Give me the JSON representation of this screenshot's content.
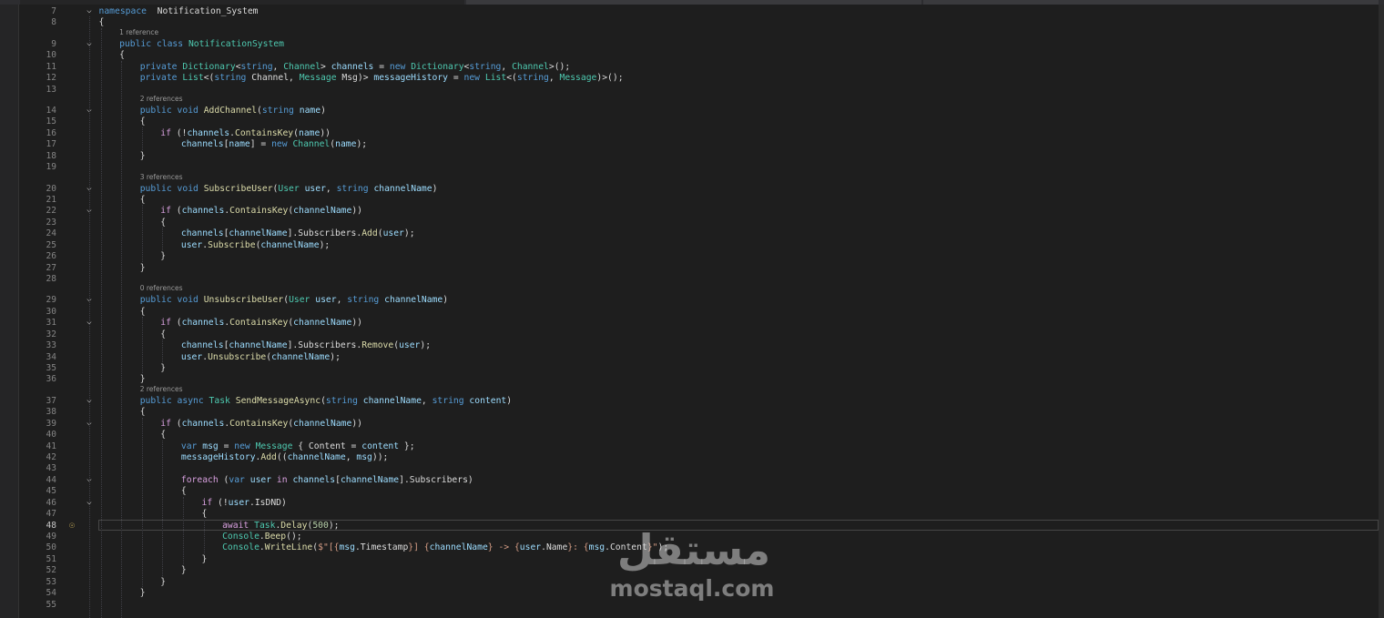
{
  "editor": {
    "current_line": 48,
    "lines": [
      {
        "n": 7,
        "fold": "v",
        "indent": 0,
        "parts": [
          [
            "kw",
            "namespace"
          ],
          [
            "",
            "  "
          ],
          [
            "",
            "Notification_System"
          ]
        ]
      },
      {
        "n": 8,
        "indent": 0,
        "parts": [
          [
            "",
            "{"
          ]
        ]
      },
      {
        "n": 9,
        "fold": "v",
        "indent": 1,
        "lens": "1 reference",
        "parts": [
          [
            "kw",
            "public"
          ],
          [
            "",
            " "
          ],
          [
            "kw",
            "class"
          ],
          [
            "",
            " "
          ],
          [
            "ty",
            "NotificationSystem"
          ]
        ]
      },
      {
        "n": 10,
        "indent": 1,
        "parts": [
          [
            "",
            "{"
          ]
        ]
      },
      {
        "n": 11,
        "indent": 2,
        "parts": [
          [
            "kw",
            "private"
          ],
          [
            "",
            " "
          ],
          [
            "ty",
            "Dictionary"
          ],
          [
            "",
            "<"
          ],
          [
            "kw",
            "string"
          ],
          [
            "",
            ", "
          ],
          [
            "ty",
            "Channel"
          ],
          [
            "",
            "> "
          ],
          [
            "id",
            "channels"
          ],
          [
            "",
            " = "
          ],
          [
            "kw",
            "new"
          ],
          [
            "",
            " "
          ],
          [
            "ty",
            "Dictionary"
          ],
          [
            "",
            "<"
          ],
          [
            "kw",
            "string"
          ],
          [
            "",
            ", "
          ],
          [
            "ty",
            "Channel"
          ],
          [
            "",
            ">();"
          ]
        ]
      },
      {
        "n": 12,
        "indent": 2,
        "parts": [
          [
            "kw",
            "private"
          ],
          [
            "",
            " "
          ],
          [
            "ty",
            "List"
          ],
          [
            "",
            "<("
          ],
          [
            "kw",
            "string"
          ],
          [
            "",
            " Channel, "
          ],
          [
            "ty",
            "Message"
          ],
          [
            "",
            " Msg)> "
          ],
          [
            "id",
            "messageHistory"
          ],
          [
            "",
            " = "
          ],
          [
            "kw",
            "new"
          ],
          [
            "",
            " "
          ],
          [
            "ty",
            "List"
          ],
          [
            "",
            "<("
          ],
          [
            "kw",
            "string"
          ],
          [
            "",
            ", "
          ],
          [
            "ty",
            "Message"
          ],
          [
            "",
            ")>();"
          ]
        ]
      },
      {
        "n": 13,
        "indent": 2,
        "parts": []
      },
      {
        "n": 14,
        "fold": "v",
        "indent": 2,
        "lens": "2 references",
        "parts": [
          [
            "kw",
            "public"
          ],
          [
            "",
            " "
          ],
          [
            "kw",
            "void"
          ],
          [
            "",
            " "
          ],
          [
            "fn",
            "AddChannel"
          ],
          [
            "",
            "("
          ],
          [
            "kw",
            "string"
          ],
          [
            "",
            " "
          ],
          [
            "id",
            "name"
          ],
          [
            "",
            ")"
          ]
        ]
      },
      {
        "n": 15,
        "indent": 2,
        "parts": [
          [
            "",
            "{"
          ]
        ]
      },
      {
        "n": 16,
        "indent": 3,
        "parts": [
          [
            "ctl",
            "if"
          ],
          [
            "",
            " (!"
          ],
          [
            "id",
            "channels"
          ],
          [
            "",
            "."
          ],
          [
            "fn",
            "ContainsKey"
          ],
          [
            "",
            "("
          ],
          [
            "id",
            "name"
          ],
          [
            "",
            "))"
          ]
        ]
      },
      {
        "n": 17,
        "indent": 4,
        "parts": [
          [
            "id",
            "channels"
          ],
          [
            "",
            "["
          ],
          [
            "id",
            "name"
          ],
          [
            "",
            "] = "
          ],
          [
            "kw",
            "new"
          ],
          [
            "",
            " "
          ],
          [
            "ty",
            "Channel"
          ],
          [
            "",
            "("
          ],
          [
            "id",
            "name"
          ],
          [
            "",
            ");"
          ]
        ]
      },
      {
        "n": 18,
        "indent": 2,
        "parts": [
          [
            "",
            "}"
          ]
        ]
      },
      {
        "n": 19,
        "indent": 2,
        "parts": []
      },
      {
        "n": 20,
        "fold": "v",
        "indent": 2,
        "lens": "3 references",
        "parts": [
          [
            "kw",
            "public"
          ],
          [
            "",
            " "
          ],
          [
            "kw",
            "void"
          ],
          [
            "",
            " "
          ],
          [
            "fn",
            "SubscribeUser"
          ],
          [
            "",
            "("
          ],
          [
            "ty",
            "User"
          ],
          [
            "",
            " "
          ],
          [
            "id",
            "user"
          ],
          [
            "",
            ", "
          ],
          [
            "kw",
            "string"
          ],
          [
            "",
            " "
          ],
          [
            "id",
            "channelName"
          ],
          [
            "",
            ")"
          ]
        ]
      },
      {
        "n": 21,
        "indent": 2,
        "parts": [
          [
            "",
            "{"
          ]
        ]
      },
      {
        "n": 22,
        "fold": "v",
        "indent": 3,
        "parts": [
          [
            "ctl",
            "if"
          ],
          [
            "",
            " ("
          ],
          [
            "id",
            "channels"
          ],
          [
            "",
            "."
          ],
          [
            "fn",
            "ContainsKey"
          ],
          [
            "",
            "("
          ],
          [
            "id",
            "channelName"
          ],
          [
            "",
            "))"
          ]
        ]
      },
      {
        "n": 23,
        "indent": 3,
        "parts": [
          [
            "",
            "{"
          ]
        ]
      },
      {
        "n": 24,
        "indent": 4,
        "parts": [
          [
            "id",
            "channels"
          ],
          [
            "",
            "["
          ],
          [
            "id",
            "channelName"
          ],
          [
            "",
            "].Subscribers."
          ],
          [
            "fn",
            "Add"
          ],
          [
            "",
            "("
          ],
          [
            "id",
            "user"
          ],
          [
            "",
            ");"
          ]
        ]
      },
      {
        "n": 25,
        "indent": 4,
        "parts": [
          [
            "id",
            "user"
          ],
          [
            "",
            "."
          ],
          [
            "fn",
            "Subscribe"
          ],
          [
            "",
            "("
          ],
          [
            "id",
            "channelName"
          ],
          [
            "",
            ");"
          ]
        ]
      },
      {
        "n": 26,
        "indent": 3,
        "parts": [
          [
            "",
            "}"
          ]
        ]
      },
      {
        "n": 27,
        "indent": 2,
        "parts": [
          [
            "",
            "}"
          ]
        ]
      },
      {
        "n": 28,
        "indent": 2,
        "parts": []
      },
      {
        "n": 29,
        "fold": "v",
        "indent": 2,
        "lens": "0 references",
        "parts": [
          [
            "kw",
            "public"
          ],
          [
            "",
            " "
          ],
          [
            "kw",
            "void"
          ],
          [
            "",
            " "
          ],
          [
            "fn",
            "UnsubscribeUser"
          ],
          [
            "",
            "("
          ],
          [
            "ty",
            "User"
          ],
          [
            "",
            " "
          ],
          [
            "id",
            "user"
          ],
          [
            "",
            ", "
          ],
          [
            "kw",
            "string"
          ],
          [
            "",
            " "
          ],
          [
            "id",
            "channelName"
          ],
          [
            "",
            ")"
          ]
        ]
      },
      {
        "n": 30,
        "indent": 2,
        "parts": [
          [
            "",
            "{"
          ]
        ]
      },
      {
        "n": 31,
        "fold": "v",
        "indent": 3,
        "parts": [
          [
            "ctl",
            "if"
          ],
          [
            "",
            " ("
          ],
          [
            "id",
            "channels"
          ],
          [
            "",
            "."
          ],
          [
            "fn",
            "ContainsKey"
          ],
          [
            "",
            "("
          ],
          [
            "id",
            "channelName"
          ],
          [
            "",
            "))"
          ]
        ]
      },
      {
        "n": 32,
        "indent": 3,
        "parts": [
          [
            "",
            "{"
          ]
        ]
      },
      {
        "n": 33,
        "indent": 4,
        "parts": [
          [
            "id",
            "channels"
          ],
          [
            "",
            "["
          ],
          [
            "id",
            "channelName"
          ],
          [
            "",
            "].Subscribers."
          ],
          [
            "fn",
            "Remove"
          ],
          [
            "",
            "("
          ],
          [
            "id",
            "user"
          ],
          [
            "",
            ");"
          ]
        ]
      },
      {
        "n": 34,
        "indent": 4,
        "parts": [
          [
            "id",
            "user"
          ],
          [
            "",
            "."
          ],
          [
            "fn",
            "Unsubscribe"
          ],
          [
            "",
            "("
          ],
          [
            "id",
            "channelName"
          ],
          [
            "",
            ");"
          ]
        ]
      },
      {
        "n": 35,
        "indent": 3,
        "parts": [
          [
            "",
            "}"
          ]
        ]
      },
      {
        "n": 36,
        "indent": 2,
        "parts": [
          [
            "",
            "}"
          ]
        ]
      },
      {
        "n": 37,
        "fold": "v",
        "indent": 2,
        "lens": "2 references",
        "parts": [
          [
            "kw",
            "public"
          ],
          [
            "",
            " "
          ],
          [
            "kw",
            "async"
          ],
          [
            "",
            " "
          ],
          [
            "ty",
            "Task"
          ],
          [
            "",
            " "
          ],
          [
            "fn",
            "SendMessageAsync"
          ],
          [
            "",
            "("
          ],
          [
            "kw",
            "string"
          ],
          [
            "",
            " "
          ],
          [
            "id",
            "channelName"
          ],
          [
            "",
            ", "
          ],
          [
            "kw",
            "string"
          ],
          [
            "",
            " "
          ],
          [
            "id",
            "content"
          ],
          [
            "",
            ")"
          ]
        ]
      },
      {
        "n": 38,
        "indent": 2,
        "parts": [
          [
            "",
            "{"
          ]
        ]
      },
      {
        "n": 39,
        "fold": "v",
        "indent": 3,
        "parts": [
          [
            "ctl",
            "if"
          ],
          [
            "",
            " ("
          ],
          [
            "id",
            "channels"
          ],
          [
            "",
            "."
          ],
          [
            "fn",
            "ContainsKey"
          ],
          [
            "",
            "("
          ],
          [
            "id",
            "channelName"
          ],
          [
            "",
            "))"
          ]
        ]
      },
      {
        "n": 40,
        "indent": 3,
        "parts": [
          [
            "",
            "{"
          ]
        ]
      },
      {
        "n": 41,
        "indent": 4,
        "parts": [
          [
            "kw",
            "var"
          ],
          [
            "",
            " "
          ],
          [
            "id",
            "msg"
          ],
          [
            "",
            " = "
          ],
          [
            "kw",
            "new"
          ],
          [
            "",
            " "
          ],
          [
            "ty",
            "Message"
          ],
          [
            "",
            " { Content = "
          ],
          [
            "id",
            "content"
          ],
          [
            "",
            " };"
          ]
        ]
      },
      {
        "n": 42,
        "indent": 4,
        "parts": [
          [
            "id",
            "messageHistory"
          ],
          [
            "",
            "."
          ],
          [
            "fn",
            "Add"
          ],
          [
            "",
            "(("
          ],
          [
            "id",
            "channelName"
          ],
          [
            "",
            ", "
          ],
          [
            "id",
            "msg"
          ],
          [
            "",
            "));"
          ]
        ]
      },
      {
        "n": 43,
        "indent": 4,
        "parts": []
      },
      {
        "n": 44,
        "fold": "v",
        "indent": 4,
        "parts": [
          [
            "ctl",
            "foreach"
          ],
          [
            "",
            " ("
          ],
          [
            "kw",
            "var"
          ],
          [
            "",
            " "
          ],
          [
            "id",
            "user"
          ],
          [
            "",
            " "
          ],
          [
            "ctl",
            "in"
          ],
          [
            "",
            " "
          ],
          [
            "id",
            "channels"
          ],
          [
            "",
            "["
          ],
          [
            "id",
            "channelName"
          ],
          [
            "",
            "].Subscribers)"
          ]
        ]
      },
      {
        "n": 45,
        "indent": 4,
        "parts": [
          [
            "",
            "{"
          ]
        ]
      },
      {
        "n": 46,
        "fold": "v",
        "indent": 5,
        "parts": [
          [
            "ctl",
            "if"
          ],
          [
            "",
            " (!"
          ],
          [
            "id",
            "user"
          ],
          [
            "",
            ".IsDND)"
          ]
        ]
      },
      {
        "n": 47,
        "indent": 5,
        "parts": [
          [
            "",
            "{"
          ]
        ]
      },
      {
        "n": 48,
        "indent": 6,
        "bulb": true,
        "parts": [
          [
            "ctl",
            "await"
          ],
          [
            "",
            " "
          ],
          [
            "ty",
            "Task"
          ],
          [
            "",
            "."
          ],
          [
            "fn",
            "Delay"
          ],
          [
            "",
            "("
          ],
          [
            "num",
            "500"
          ],
          [
            "",
            ");"
          ]
        ]
      },
      {
        "n": 49,
        "indent": 6,
        "parts": [
          [
            "ty",
            "Console"
          ],
          [
            "",
            "."
          ],
          [
            "fn",
            "Beep"
          ],
          [
            "",
            "();"
          ]
        ]
      },
      {
        "n": 50,
        "indent": 6,
        "parts": [
          [
            "ty",
            "Console"
          ],
          [
            "",
            "."
          ],
          [
            "fn",
            "WriteLine"
          ],
          [
            "",
            "("
          ],
          [
            "str",
            "$\"[{"
          ],
          [
            "id",
            "msg"
          ],
          [
            "",
            ".Timestamp"
          ],
          [
            "str",
            "}] {"
          ],
          [
            "id",
            "channelName"
          ],
          [
            "str",
            "} -> {"
          ],
          [
            "id",
            "user"
          ],
          [
            "",
            ".Name"
          ],
          [
            "str",
            "}: {"
          ],
          [
            "id",
            "msg"
          ],
          [
            "",
            ".Content"
          ],
          [
            "str",
            "}\""
          ],
          [
            "",
            ");"
          ]
        ]
      },
      {
        "n": 51,
        "indent": 5,
        "parts": [
          [
            "",
            "}"
          ]
        ]
      },
      {
        "n": 52,
        "indent": 4,
        "parts": [
          [
            "",
            "}"
          ]
        ]
      },
      {
        "n": 53,
        "indent": 3,
        "parts": [
          [
            "",
            "}"
          ]
        ]
      },
      {
        "n": 54,
        "indent": 2,
        "parts": [
          [
            "",
            "}"
          ]
        ]
      },
      {
        "n": 55,
        "indent": 2,
        "parts": []
      }
    ]
  },
  "watermark": {
    "arabic": "مستقل",
    "latin": "mostaql.com"
  }
}
